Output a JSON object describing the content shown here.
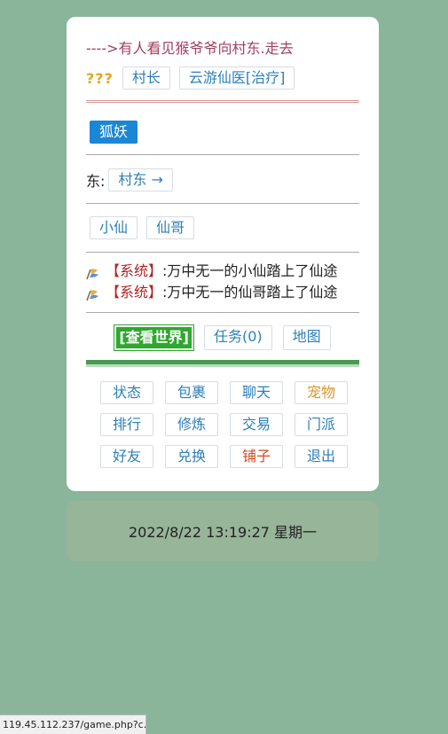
{
  "announcement": "---->有人看见猴爷爷向村东.走去",
  "npc": {
    "unknown_label": "???",
    "buttons": [
      "村长",
      "云游仙医[治疗]"
    ]
  },
  "monster": "狐妖",
  "direction": {
    "label": "东:",
    "exit": "村东",
    "arrow": "→"
  },
  "players": [
    "小仙",
    "仙哥"
  ],
  "messages": [
    {
      "tag": "【系统】",
      "text": ":万中无一的小仙踏上了仙途"
    },
    {
      "tag": "【系统】",
      "text": ":万中无一的仙哥踏上了仙途"
    }
  ],
  "center_links": {
    "world": "[查看世界]",
    "tasks": "任务(0)",
    "map": "地图"
  },
  "menu": [
    {
      "label": "状态",
      "color": "#2d7fb8"
    },
    {
      "label": "包裹",
      "color": "#2d7fb8"
    },
    {
      "label": "聊天",
      "color": "#2d7fb8"
    },
    {
      "label": "宠物",
      "color": "#d7962a"
    },
    {
      "label": "排行",
      "color": "#2d7fb8"
    },
    {
      "label": "修炼",
      "color": "#2d7fb8"
    },
    {
      "label": "交易",
      "color": "#2d7fb8"
    },
    {
      "label": "门派",
      "color": "#2d7fb8"
    },
    {
      "label": "好友",
      "color": "#2d7fb8"
    },
    {
      "label": "兑换",
      "color": "#2d7fb8"
    },
    {
      "label": "铺子",
      "color": "#d14a1e"
    },
    {
      "label": "退出",
      "color": "#2d7fb8"
    }
  ],
  "datetime": "2022/8/22 13:19:27 星期一",
  "status_url": "119.45.112.237/game.php?c..."
}
